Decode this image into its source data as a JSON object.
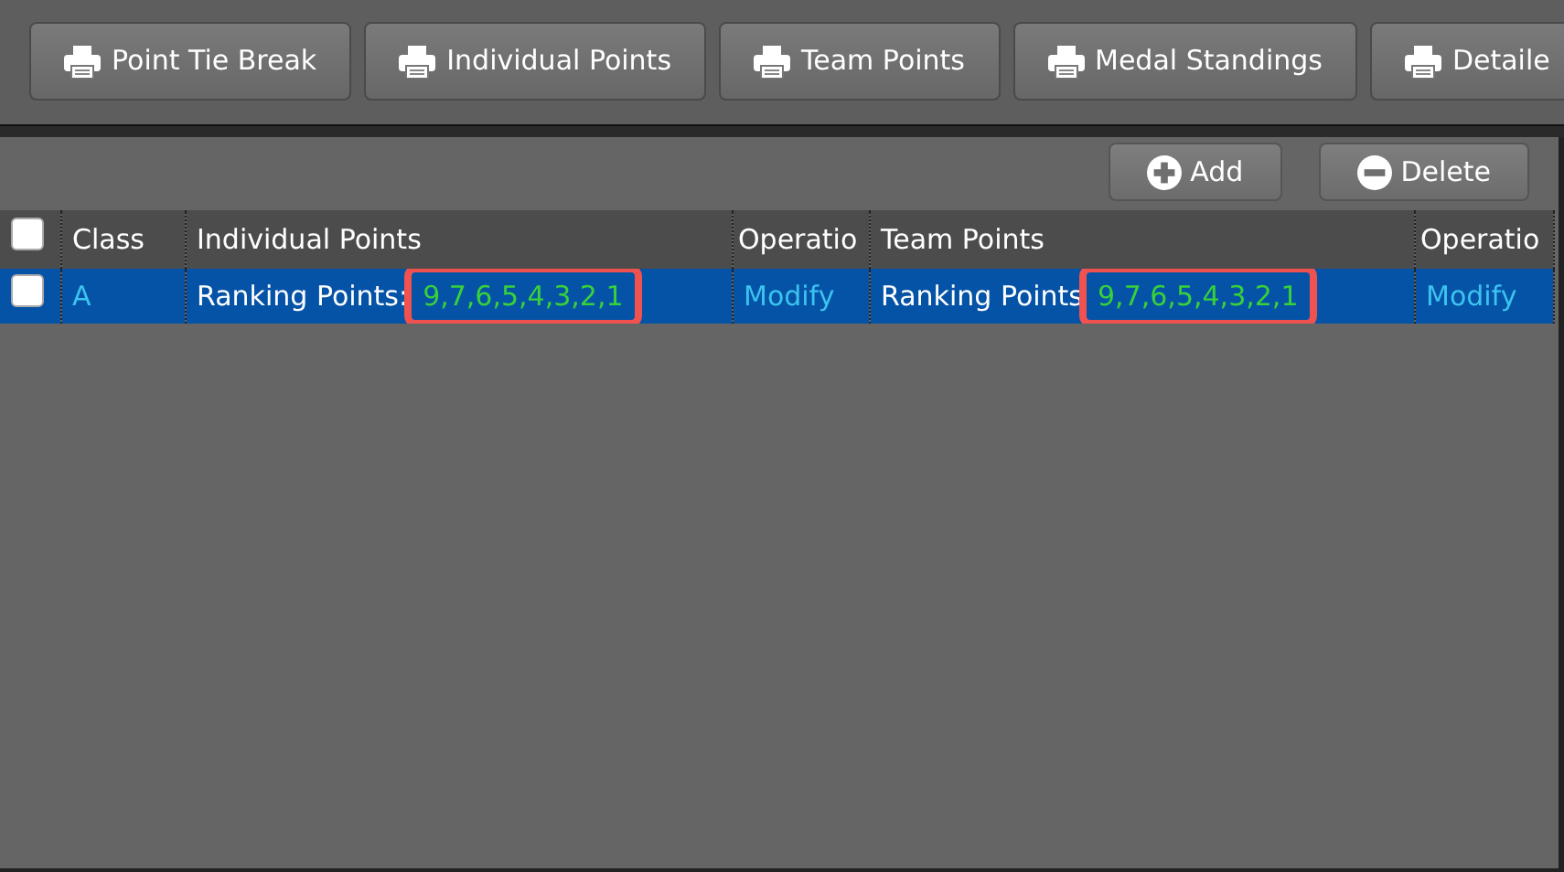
{
  "report_buttons": [
    {
      "label": "Point Tie Break"
    },
    {
      "label": "Individual Points"
    },
    {
      "label": "Team Points"
    },
    {
      "label": "Medal Standings"
    },
    {
      "label": "Detaile"
    }
  ],
  "actions": [
    {
      "kind": "add",
      "label": "Add"
    },
    {
      "kind": "delete",
      "label": "Delete"
    }
  ],
  "table": {
    "header_checked": false,
    "columns": [
      "Class",
      "Individual Points",
      "Operatio",
      "Team Points",
      "Operatio"
    ],
    "rows": [
      {
        "checked": false,
        "selected": true,
        "class": "A",
        "individual_label": "Ranking Points:",
        "individual_value": "9,7,6,5,4,3,2,1",
        "individual_highlighted": true,
        "operation_1": "Modify",
        "team_label": "Ranking Points",
        "team_value": "9,7,6,5,4,3,2,1",
        "team_highlighted": true,
        "operation_2": "Modify"
      }
    ]
  }
}
